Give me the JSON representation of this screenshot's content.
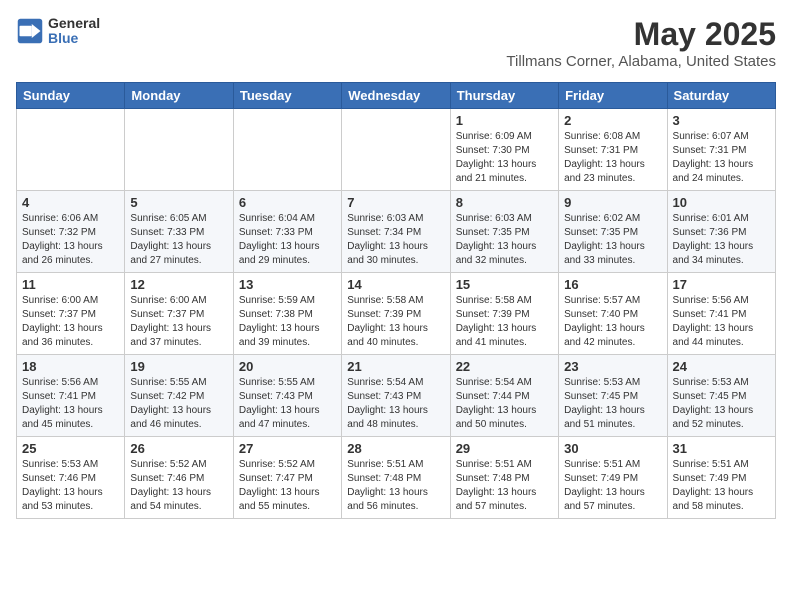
{
  "header": {
    "logo_general": "General",
    "logo_blue": "Blue",
    "month": "May 2025",
    "location": "Tillmans Corner, Alabama, United States"
  },
  "weekdays": [
    "Sunday",
    "Monday",
    "Tuesday",
    "Wednesday",
    "Thursday",
    "Friday",
    "Saturday"
  ],
  "weeks": [
    [
      {
        "day": "",
        "info": ""
      },
      {
        "day": "",
        "info": ""
      },
      {
        "day": "",
        "info": ""
      },
      {
        "day": "",
        "info": ""
      },
      {
        "day": "1",
        "info": "Sunrise: 6:09 AM\nSunset: 7:30 PM\nDaylight: 13 hours\nand 21 minutes."
      },
      {
        "day": "2",
        "info": "Sunrise: 6:08 AM\nSunset: 7:31 PM\nDaylight: 13 hours\nand 23 minutes."
      },
      {
        "day": "3",
        "info": "Sunrise: 6:07 AM\nSunset: 7:31 PM\nDaylight: 13 hours\nand 24 minutes."
      }
    ],
    [
      {
        "day": "4",
        "info": "Sunrise: 6:06 AM\nSunset: 7:32 PM\nDaylight: 13 hours\nand 26 minutes."
      },
      {
        "day": "5",
        "info": "Sunrise: 6:05 AM\nSunset: 7:33 PM\nDaylight: 13 hours\nand 27 minutes."
      },
      {
        "day": "6",
        "info": "Sunrise: 6:04 AM\nSunset: 7:33 PM\nDaylight: 13 hours\nand 29 minutes."
      },
      {
        "day": "7",
        "info": "Sunrise: 6:03 AM\nSunset: 7:34 PM\nDaylight: 13 hours\nand 30 minutes."
      },
      {
        "day": "8",
        "info": "Sunrise: 6:03 AM\nSunset: 7:35 PM\nDaylight: 13 hours\nand 32 minutes."
      },
      {
        "day": "9",
        "info": "Sunrise: 6:02 AM\nSunset: 7:35 PM\nDaylight: 13 hours\nand 33 minutes."
      },
      {
        "day": "10",
        "info": "Sunrise: 6:01 AM\nSunset: 7:36 PM\nDaylight: 13 hours\nand 34 minutes."
      }
    ],
    [
      {
        "day": "11",
        "info": "Sunrise: 6:00 AM\nSunset: 7:37 PM\nDaylight: 13 hours\nand 36 minutes."
      },
      {
        "day": "12",
        "info": "Sunrise: 6:00 AM\nSunset: 7:37 PM\nDaylight: 13 hours\nand 37 minutes."
      },
      {
        "day": "13",
        "info": "Sunrise: 5:59 AM\nSunset: 7:38 PM\nDaylight: 13 hours\nand 39 minutes."
      },
      {
        "day": "14",
        "info": "Sunrise: 5:58 AM\nSunset: 7:39 PM\nDaylight: 13 hours\nand 40 minutes."
      },
      {
        "day": "15",
        "info": "Sunrise: 5:58 AM\nSunset: 7:39 PM\nDaylight: 13 hours\nand 41 minutes."
      },
      {
        "day": "16",
        "info": "Sunrise: 5:57 AM\nSunset: 7:40 PM\nDaylight: 13 hours\nand 42 minutes."
      },
      {
        "day": "17",
        "info": "Sunrise: 5:56 AM\nSunset: 7:41 PM\nDaylight: 13 hours\nand 44 minutes."
      }
    ],
    [
      {
        "day": "18",
        "info": "Sunrise: 5:56 AM\nSunset: 7:41 PM\nDaylight: 13 hours\nand 45 minutes."
      },
      {
        "day": "19",
        "info": "Sunrise: 5:55 AM\nSunset: 7:42 PM\nDaylight: 13 hours\nand 46 minutes."
      },
      {
        "day": "20",
        "info": "Sunrise: 5:55 AM\nSunset: 7:43 PM\nDaylight: 13 hours\nand 47 minutes."
      },
      {
        "day": "21",
        "info": "Sunrise: 5:54 AM\nSunset: 7:43 PM\nDaylight: 13 hours\nand 48 minutes."
      },
      {
        "day": "22",
        "info": "Sunrise: 5:54 AM\nSunset: 7:44 PM\nDaylight: 13 hours\nand 50 minutes."
      },
      {
        "day": "23",
        "info": "Sunrise: 5:53 AM\nSunset: 7:45 PM\nDaylight: 13 hours\nand 51 minutes."
      },
      {
        "day": "24",
        "info": "Sunrise: 5:53 AM\nSunset: 7:45 PM\nDaylight: 13 hours\nand 52 minutes."
      }
    ],
    [
      {
        "day": "25",
        "info": "Sunrise: 5:53 AM\nSunset: 7:46 PM\nDaylight: 13 hours\nand 53 minutes."
      },
      {
        "day": "26",
        "info": "Sunrise: 5:52 AM\nSunset: 7:46 PM\nDaylight: 13 hours\nand 54 minutes."
      },
      {
        "day": "27",
        "info": "Sunrise: 5:52 AM\nSunset: 7:47 PM\nDaylight: 13 hours\nand 55 minutes."
      },
      {
        "day": "28",
        "info": "Sunrise: 5:51 AM\nSunset: 7:48 PM\nDaylight: 13 hours\nand 56 minutes."
      },
      {
        "day": "29",
        "info": "Sunrise: 5:51 AM\nSunset: 7:48 PM\nDaylight: 13 hours\nand 57 minutes."
      },
      {
        "day": "30",
        "info": "Sunrise: 5:51 AM\nSunset: 7:49 PM\nDaylight: 13 hours\nand 57 minutes."
      },
      {
        "day": "31",
        "info": "Sunrise: 5:51 AM\nSunset: 7:49 PM\nDaylight: 13 hours\nand 58 minutes."
      }
    ]
  ]
}
